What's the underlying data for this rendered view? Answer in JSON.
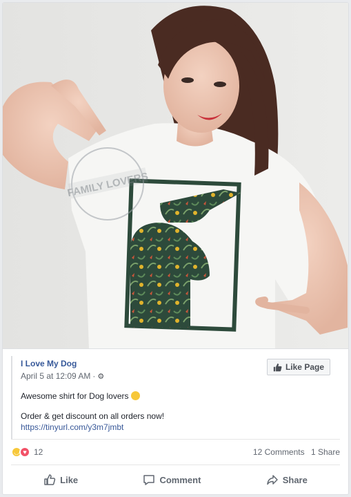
{
  "post": {
    "image_watermark": {
      "brand": "FAMILY LOVERS",
      "url": "https://www.familylovers.com"
    },
    "page_name": "I Love My Dog",
    "timestamp": "April 5 at 12:09 AM",
    "meta_separator": "·",
    "privacy_icon": "gear-icon",
    "like_page_label": "Like Page",
    "text_line1": "Awesome shirt for Dog lovers",
    "emoji": "laughing-emoji",
    "text_line2": "Order & get discount on all orders now!",
    "link": "https://tinyurl.com/y3m7jmbt"
  },
  "stats": {
    "reaction_icons": [
      "haha-reaction-icon",
      "love-reaction-icon"
    ],
    "reaction_count": "12",
    "comments": "12 Comments",
    "shares": "1 Share"
  },
  "actions": {
    "like": "Like",
    "comment": "Comment",
    "share": "Share"
  },
  "colors": {
    "link_blue": "#365899",
    "text_gray": "#616770",
    "shirt_print_green": "#2f4a3c",
    "haha_yellow": "#f7c83a",
    "love_red": "#f25268"
  }
}
